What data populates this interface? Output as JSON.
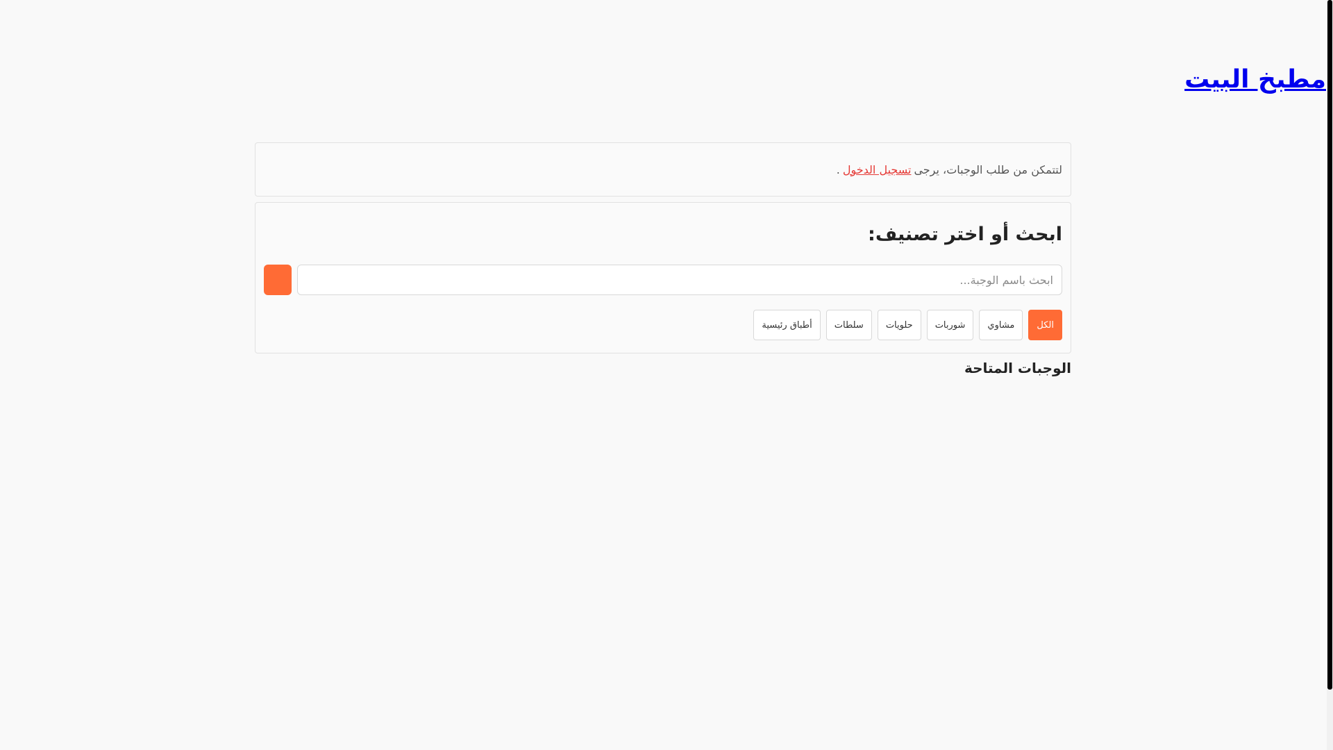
{
  "site": {
    "title": "مطبخ البيت"
  },
  "notice": {
    "text_before": "لتتمكن من طلب الوجبات، يرجى",
    "link_label": "تسجيل الدخول",
    "text_after": "."
  },
  "search": {
    "heading": "ابحث أو اختر تصنيف:",
    "placeholder": "ابحث باسم الوجبة...",
    "value": "",
    "button_icon": "search-icon"
  },
  "categories": {
    "items": [
      {
        "label": "الكل",
        "active": true
      },
      {
        "label": "مشاوي",
        "active": false
      },
      {
        "label": "شوربات",
        "active": false
      },
      {
        "label": "حلويات",
        "active": false
      },
      {
        "label": "سلطات",
        "active": false
      },
      {
        "label": "أطباق رئيسية",
        "active": false
      }
    ]
  },
  "meals": {
    "title": "الوجبات المتاحة"
  },
  "colors": {
    "accent": "#ff6b35",
    "link": "#0000ee",
    "notice_link": "#e53935"
  }
}
